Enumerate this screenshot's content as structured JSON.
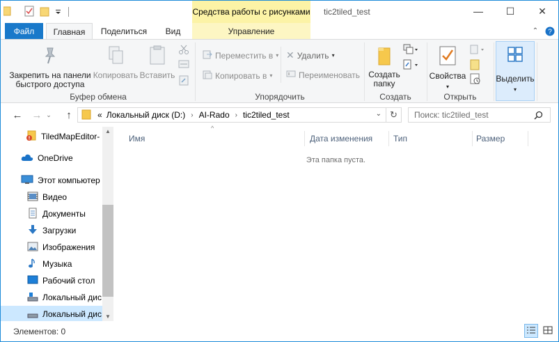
{
  "window": {
    "title": "tic2tiled_test",
    "context_tab": "Средства работы с рисунками",
    "controls": {
      "minimize": "—",
      "maximize": "☐",
      "close": "✕"
    }
  },
  "ribbon_tabs": {
    "file": "Файл",
    "home": "Главная",
    "share": "Поделиться",
    "view": "Вид",
    "manage": "Управление"
  },
  "ribbon": {
    "clipboard": {
      "label": "Буфер обмена",
      "pin": "Закрепить на панели быстрого доступа",
      "copy": "Копировать",
      "paste": "Вставить"
    },
    "organize": {
      "label": "Упорядочить",
      "move_to": "Переместить в",
      "copy_to": "Копировать в",
      "delete": "Удалить",
      "rename": "Переименовать"
    },
    "new": {
      "label": "Создать",
      "new_folder": "Создать папку"
    },
    "open": {
      "label": "Открыть",
      "properties": "Свойства"
    },
    "select": {
      "select_label": "Выделить"
    }
  },
  "address": {
    "overflow": "«",
    "crumbs": [
      "Локальный диск (D:)",
      "AI-Rado",
      "tic2tiled_test"
    ],
    "search_placeholder": "Поиск: tic2tiled_test"
  },
  "nav_pane": {
    "items": [
      {
        "label": "TiledMapEditor-",
        "icon": "folder-warning-icon"
      },
      {
        "label": "OneDrive",
        "icon": "onedrive-icon"
      },
      {
        "label": "Этот компьютер",
        "icon": "computer-icon"
      },
      {
        "label": "Видео",
        "icon": "video-icon"
      },
      {
        "label": "Документы",
        "icon": "documents-icon"
      },
      {
        "label": "Загрузки",
        "icon": "downloads-icon"
      },
      {
        "label": "Изображения",
        "icon": "pictures-icon"
      },
      {
        "label": "Музыка",
        "icon": "music-icon"
      },
      {
        "label": "Рабочий стол",
        "icon": "desktop-icon"
      },
      {
        "label": "Локальный дис",
        "icon": "drive-icon"
      },
      {
        "label": "Локальный дис",
        "icon": "drive-icon"
      }
    ]
  },
  "content": {
    "columns": [
      "Имя",
      "Дата изменения",
      "Тип",
      "Размер"
    ],
    "empty_message": "Эта папка пуста."
  },
  "status": {
    "items_count": "Элементов: 0"
  },
  "colors": {
    "accent": "#1979ca",
    "context_tab": "#fcf3a6",
    "selection": "#cce8ff"
  }
}
